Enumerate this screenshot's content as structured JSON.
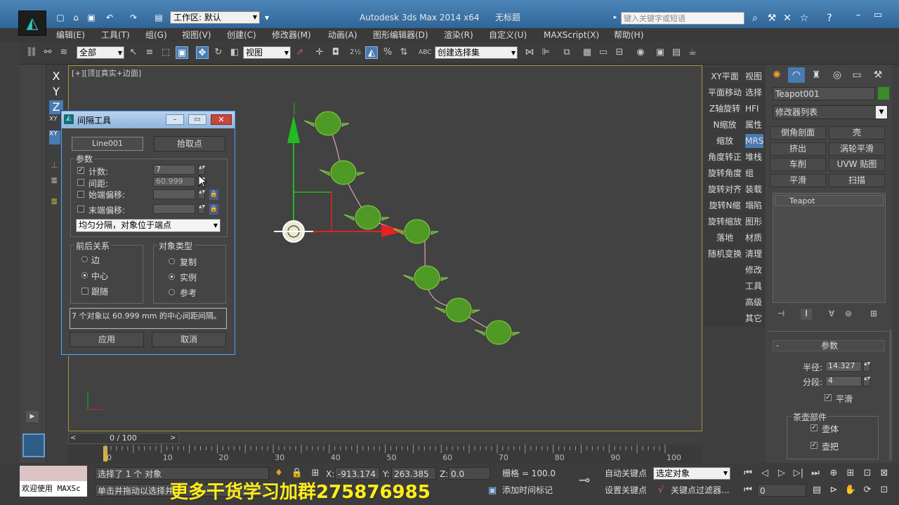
{
  "titlebar": {
    "workspace": "工作区: 默认",
    "app_title": "Autodesk 3ds Max  2014 x64",
    "doc_title": "无标题",
    "search_placeholder": "键入关键字或短语"
  },
  "menu": [
    "编辑(E)",
    "工具(T)",
    "组(G)",
    "视图(V)",
    "创建(C)",
    "修改器(M)",
    "动画(A)",
    "图形编辑器(D)",
    "渲染(R)",
    "自定义(U)",
    "MAXScript(X)",
    "帮助(H)"
  ],
  "toolbar": {
    "selection_filter": "全部",
    "ref_coord": "视图",
    "named_selection": "创建选择集"
  },
  "axes": [
    "X",
    "Y",
    "Z"
  ],
  "viewport": {
    "label": "[+][顶][真实+边面]"
  },
  "mid_panel": {
    "col1": [
      "XY平面",
      "平面移动",
      "Z轴旋转",
      "N缩放",
      "缩放",
      "角度转正",
      "旋转角度",
      "旋转对齐",
      "旋转N缩",
      "旋转缩放",
      "落地",
      "随机变换"
    ],
    "col2": [
      "视图",
      "选择",
      "HFI",
      "属性",
      "MRS",
      "堆栈",
      "组",
      "装载",
      "塌陷",
      "图形",
      "材质",
      "清理",
      "修改",
      "工具",
      "高级",
      "其它"
    ]
  },
  "command_panel": {
    "object_name": "Teapot001",
    "object_color": "#3a8a2a",
    "modifier_list": "修改器列表",
    "modifier_buttons": [
      "倒角剖面",
      "壳",
      "挤出",
      "涡轮平滑",
      "车削",
      "UVW 贴图",
      "平滑",
      "扫描"
    ],
    "stack_item": "Teapot",
    "rollout_title": "参数",
    "radius_label": "半径:",
    "radius_value": "14.327",
    "segments_label": "分段:",
    "segments_value": "4",
    "smooth_label": "平滑",
    "parts_label": "茶壶部件",
    "body_label": "壶体",
    "handle_label": "壶把"
  },
  "dialog": {
    "title": "间隔工具",
    "path_button": "Line001",
    "pick_points_button": "拾取点",
    "params_label": "参数",
    "count_label": "计数:",
    "count_value": "7",
    "spacing_label": "间距:",
    "spacing_value": "60.999",
    "start_offset_label": "始端偏移:",
    "end_offset_label": "末端偏移:",
    "distribution": "均匀分隔，对象位于端点",
    "context_label": "前后关系",
    "edges_label": "边",
    "centers_label": "中心",
    "follow_label": "跟随",
    "object_type_label": "对象类型",
    "copy_label": "复制",
    "instance_label": "实例",
    "reference_label": "参考",
    "info_text": "7 个对象以 60.999 mm 的中心间距间隔。",
    "apply_button": "应用",
    "cancel_button": "取消"
  },
  "timeline": {
    "frame_display": "0 / 100",
    "ticks": [
      "0",
      "10",
      "20",
      "30",
      "40",
      "50",
      "60",
      "70",
      "80",
      "90",
      "100"
    ]
  },
  "status": {
    "maxscript_text": "欢迎使用 MAXSc",
    "selection_text": "选择了 1 个 对象",
    "prompt_text": "单击并拖动以选择并",
    "x_label": "X:",
    "x_value": "-913.174",
    "y_label": "Y:",
    "y_value": "263.385",
    "z_label": "Z:",
    "z_value": "0.0",
    "grid_text": "栅格 = 100.0",
    "add_time_tag": "添加时间标记",
    "auto_key": "自动关键点",
    "set_key": "设置关键点",
    "selected_object": "选定对象",
    "key_filters": "关键点过滤器...",
    "frame_value": "0",
    "banner": "更多干货学习加群275876985"
  }
}
